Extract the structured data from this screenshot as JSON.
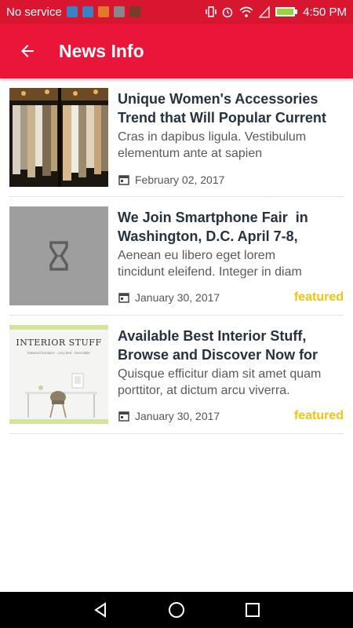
{
  "status_bar": {
    "carrier": "No service",
    "time": "4:50 PM"
  },
  "app_bar": {
    "title": "News Info"
  },
  "articles": [
    {
      "title_line1": "Unique Women's Accessories",
      "title_line2": "Trend that Will Popular Current",
      "excerpt_line1": "Cras in dapibus ligula. Vestibulum",
      "excerpt_line2": "elementum ante at sapien",
      "date": "February 02, 2017",
      "featured": ""
    },
    {
      "title_line1": "We Join Smartphone Fair  in",
      "title_line2": "Washington, D.C. April 7-8,",
      "excerpt_line1": "Aenean eu libero eget lorem",
      "excerpt_line2": "tincidunt eleifend. Integer in diam",
      "date": "January 30, 2017",
      "featured": "featured"
    },
    {
      "title_line1": "Available Best Interior Stuff,",
      "title_line2": "Browse and Discover Now for",
      "excerpt_line1": "Quisque efficitur diam sit amet quam",
      "excerpt_line2": "porttitor, at dictum arcu viverra.",
      "date": "January 30, 2017",
      "featured": "featured",
      "thumb_heading": "INTERIOR STUFF",
      "thumb_sub": "featured furniture - cozy bed - best table"
    }
  ],
  "colors": {
    "status_bar": "#d8162f",
    "app_bar": "#e9163a",
    "title": "#27323f",
    "featured": "#f1c40f"
  }
}
